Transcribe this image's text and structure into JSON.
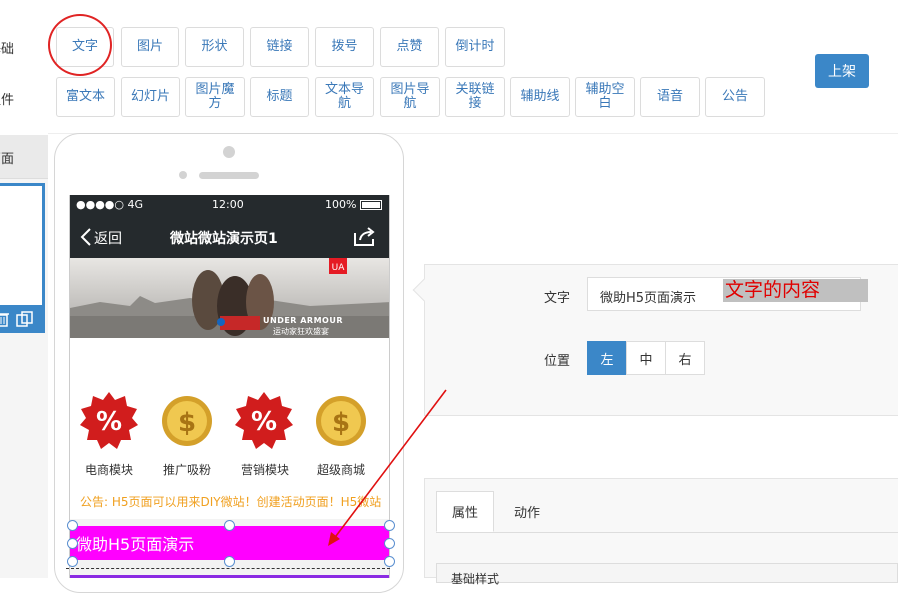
{
  "rows": {
    "basic_label": "基础",
    "component_label": "组件"
  },
  "toolbar": {
    "basic": [
      "文字",
      "图片",
      "形状",
      "链接",
      "拨号",
      "点赞",
      "倒计时"
    ],
    "components": [
      "富文本",
      "幻灯片",
      "图片魔方",
      "标题",
      "文本导航",
      "图片导航",
      "关联链接",
      "辅助线",
      "辅助空白",
      "语音",
      "公告"
    ],
    "publish": "上架"
  },
  "left_panel": {
    "page_label": "页面"
  },
  "phone": {
    "status": {
      "carrier": "●●●●○ 4G",
      "time": "12:00",
      "battery": "100%"
    },
    "nav": {
      "back": "返回",
      "title": "微站微站演示页1"
    },
    "banner": {
      "brand": "UNDER ARMOUR",
      "caption": "运动家狂欢盛宴"
    },
    "icons": [
      {
        "label": "电商模块",
        "icon": "percent-badge-icon"
      },
      {
        "label": "推广吸粉",
        "icon": "dollar-coin-icon"
      },
      {
        "label": "营销模块",
        "icon": "percent-badge-icon"
      },
      {
        "label": "超级商城",
        "icon": "dollar-coin-icon"
      }
    ],
    "notice": "公告: H5页面可以用来DIY微站！创建活动页面！H5微站",
    "text_block": "微助H5页面演示"
  },
  "editor": {
    "text_label": "文字",
    "text_value": "微助H5页面演示",
    "annotation": "文字的内容",
    "align_label": "位置",
    "align_options": [
      "左",
      "中",
      "右"
    ],
    "align_selected": "左"
  },
  "tabs": [
    "属性",
    "动作"
  ],
  "subpanel_title": "基础样式",
  "colors": {
    "accent": "#3b87c8",
    "highlight": "#ff00ff",
    "annotation": "#e00000"
  }
}
